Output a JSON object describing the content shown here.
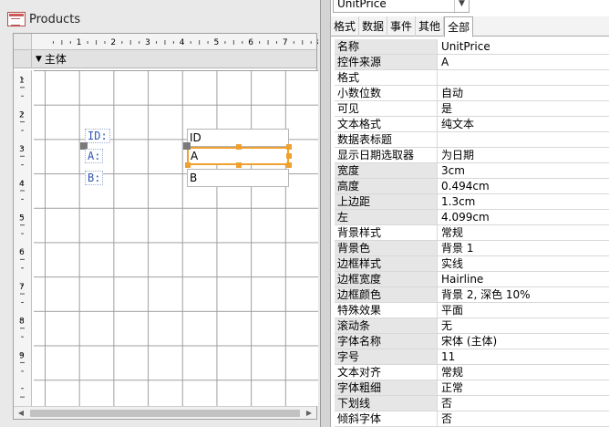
{
  "form": {
    "title": "Products",
    "section_label": "主体",
    "h_ruler_marks": [
      "1",
      "2",
      "3",
      "4",
      "5",
      "6",
      "7",
      "8"
    ],
    "v_ruler_marks": [
      "1",
      "2",
      "3",
      "4",
      "5",
      "6",
      "7",
      "8",
      "9"
    ],
    "controls": {
      "label_id": "ID:",
      "label_a": "A:",
      "label_b": "B:",
      "text_id": "ID",
      "text_a": "A",
      "text_b": "B"
    }
  },
  "property_sheet": {
    "selected_object": "UnitPrice",
    "tabs": [
      "格式",
      "数据",
      "事件",
      "其他",
      "全部"
    ],
    "active_tab": "全部",
    "properties": [
      {
        "name": "名称",
        "value": "UnitPrice"
      },
      {
        "name": "控件来源",
        "value": "A"
      },
      {
        "name": "格式",
        "value": ""
      },
      {
        "name": "小数位数",
        "value": "自动"
      },
      {
        "name": "可见",
        "value": "是"
      },
      {
        "name": "文本格式",
        "value": "纯文本"
      },
      {
        "name": "数据表标题",
        "value": ""
      },
      {
        "name": "显示日期选取器",
        "value": "为日期"
      },
      {
        "name": "宽度",
        "value": "3cm"
      },
      {
        "name": "高度",
        "value": "0.494cm"
      },
      {
        "name": "上边距",
        "value": "1.3cm"
      },
      {
        "name": "左",
        "value": "4.099cm"
      },
      {
        "name": "背景样式",
        "value": "常规"
      },
      {
        "name": "背景色",
        "value": "背景 1"
      },
      {
        "name": "边框样式",
        "value": "实线"
      },
      {
        "name": "边框宽度",
        "value": "Hairline"
      },
      {
        "name": "边框颜色",
        "value": "背景 2, 深色 10%"
      },
      {
        "name": "特殊效果",
        "value": "平面"
      },
      {
        "name": "滚动条",
        "value": "无"
      },
      {
        "name": "字体名称",
        "value": "宋体 (主体)"
      },
      {
        "name": "字号",
        "value": "11"
      },
      {
        "name": "文本对齐",
        "value": "常规"
      },
      {
        "name": "字体粗细",
        "value": "正常"
      },
      {
        "name": "下划线",
        "value": "否"
      },
      {
        "name": "倾斜字体",
        "value": "否"
      }
    ]
  },
  "colors": {
    "selection": "#f0a030",
    "label_text": "#2f57b3",
    "grid_line": "#9f9f9f"
  },
  "icons": {
    "form": "form-icon",
    "section": "triangle-down-icon",
    "dropdown": "chevron-down-icon"
  }
}
